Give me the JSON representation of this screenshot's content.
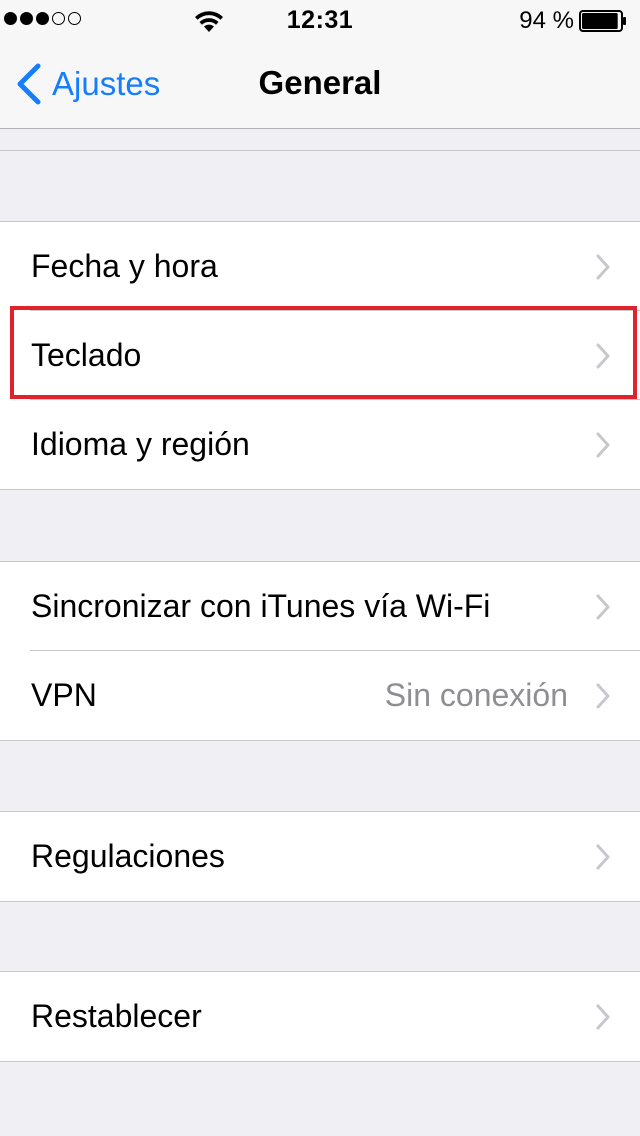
{
  "status_bar": {
    "signal_dots_filled": 3,
    "signal_dots_total": 5,
    "time": "12:31",
    "battery_percent": "94 %",
    "battery_level": 0.94
  },
  "nav": {
    "back_label": "Ajustes",
    "title": "General"
  },
  "groups": [
    {
      "items": [
        {
          "label": "Fecha y hora",
          "detail": ""
        },
        {
          "label": "Teclado",
          "detail": "",
          "highlighted": true
        },
        {
          "label": "Idioma y región",
          "detail": ""
        }
      ]
    },
    {
      "items": [
        {
          "label": "Sincronizar con iTunes vía Wi-Fi",
          "detail": ""
        },
        {
          "label": "VPN",
          "detail": "Sin conexión"
        }
      ]
    },
    {
      "items": [
        {
          "label": "Regulaciones",
          "detail": ""
        }
      ]
    },
    {
      "items": [
        {
          "label": "Restablecer",
          "detail": ""
        }
      ]
    }
  ],
  "colors": {
    "accent": "#147efb",
    "highlight": "#e0222c",
    "background": "#efeff4",
    "detail_text": "#8e8e93",
    "chevron": "#c7c7cc"
  },
  "icons": {
    "back": "chevron-left-icon",
    "disclosure": "chevron-right-icon",
    "wifi": "wifi-icon",
    "battery": "battery-icon"
  }
}
